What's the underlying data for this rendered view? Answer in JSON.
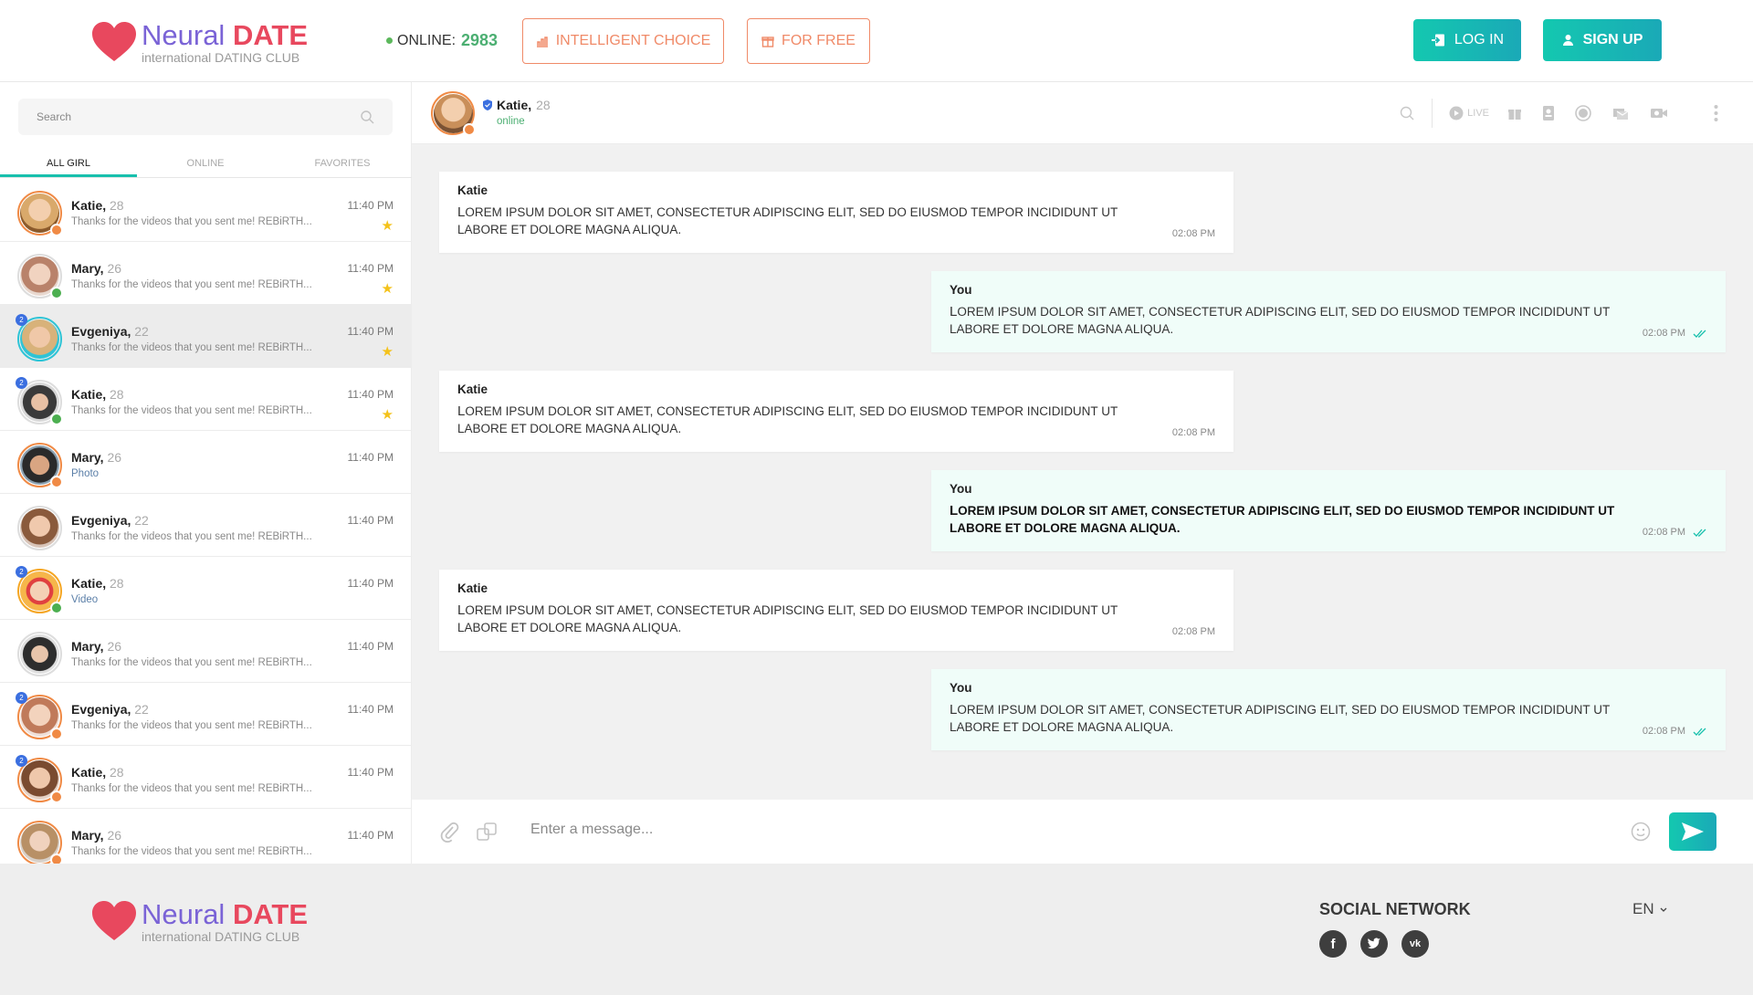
{
  "brand": {
    "name_part1": "Neural",
    "name_part2": "DATE",
    "tagline": "international DATING CLUB",
    "heart_color": "#e8485e"
  },
  "header": {
    "online_label": "ONLINE:",
    "online_count": "2983",
    "intelligent_choice_label": "INTELLIGENT CHOICE",
    "for_free_label": "FOR FREE",
    "login_label": "LOG IN",
    "signup_label": "SIGN UP"
  },
  "sidebar": {
    "search_placeholder": "Search",
    "tabs": [
      {
        "label": "ALL GIRL",
        "active": true
      },
      {
        "label": "ONLINE"
      },
      {
        "label": "FAVORITES"
      }
    ],
    "contacts": [
      {
        "name": "Katie,",
        "age": "28",
        "preview": "Thanks for the videos that you sent me! REBiRTH...",
        "time": "11:40 PM",
        "star": "★",
        "ring": "#f08a45",
        "badge": "#f08a45",
        "num": "",
        "selected": false,
        "media": false
      },
      {
        "name": "Mary,",
        "age": "26",
        "preview": "Thanks for the videos that you sent me! REBiRTH...",
        "time": "11:40 PM",
        "star": "★",
        "ring": "#dddddd",
        "badge": "#4caf50",
        "num": "",
        "selected": false,
        "media": false
      },
      {
        "name": "Evgeniya,",
        "age": "22",
        "preview": "Thanks for the videos that you sent me! REBiRTH...",
        "time": "11:40 PM",
        "star": "★",
        "ring": "#2ec4d6",
        "badge": "",
        "num": "2",
        "selected": true,
        "media": false
      },
      {
        "name": "Katie,",
        "age": "28",
        "preview": "Thanks for the videos that you sent me! REBiRTH...",
        "time": "11:40 PM",
        "star": "★",
        "ring": "#dddddd",
        "badge": "#4caf50",
        "num": "2",
        "selected": false,
        "media": false
      },
      {
        "name": "Mary,",
        "age": "26",
        "preview": "Photo",
        "time": "11:40 PM",
        "star": "",
        "ring": "#f08a45",
        "badge": "#f08a45",
        "num": "",
        "selected": false,
        "media": true
      },
      {
        "name": "Evgeniya,",
        "age": "22",
        "preview": "Thanks for the videos that you sent me! REBiRTH...",
        "time": "11:40 PM",
        "star": "",
        "ring": "#dddddd",
        "badge": "",
        "num": "",
        "selected": false,
        "media": false
      },
      {
        "name": "Katie,",
        "age": "28",
        "preview": "Video",
        "time": "11:40 PM",
        "star": "",
        "ring": "#f5a623",
        "badge": "#4caf50",
        "num": "2",
        "selected": false,
        "media": true
      },
      {
        "name": "Mary,",
        "age": "26",
        "preview": "Thanks for the videos that you sent me! REBiRTH...",
        "time": "11:40 PM",
        "star": "",
        "ring": "#dddddd",
        "badge": "",
        "num": "",
        "selected": false,
        "media": false
      },
      {
        "name": "Evgeniya,",
        "age": "22",
        "preview": "Thanks for the videos that you sent me! REBiRTH...",
        "time": "11:40 PM",
        "star": "",
        "ring": "#f08a45",
        "badge": "#f08a45",
        "num": "2",
        "selected": false,
        "media": false
      },
      {
        "name": "Katie,",
        "age": "28",
        "preview": "Thanks for the videos that you sent me! REBiRTH...",
        "time": "11:40 PM",
        "star": "",
        "ring": "#f08a45",
        "badge": "#f08a45",
        "num": "2",
        "selected": false,
        "media": false
      },
      {
        "name": "Mary,",
        "age": "26",
        "preview": "Thanks for the videos that you sent me! REBiRTH...",
        "time": "11:40 PM",
        "star": "",
        "ring": "#f08a45",
        "badge": "#f08a45",
        "num": "",
        "selected": false,
        "media": false
      }
    ]
  },
  "chat": {
    "contact_name": "Katie,",
    "contact_age": "28",
    "contact_status": "online",
    "live_label": "LIVE",
    "messages": [
      {
        "dir": "in",
        "author": "Katie",
        "text": "LOREM IPSUM DOLOR SIT AMET, CONSECTETUR ADIPISCING ELIT, SED DO EIUSMOD TEMPOR INCIDIDUNT UT LABORE ET DOLORE MAGNA ALIQUA.",
        "time": "02:08 PM",
        "bold": false
      },
      {
        "dir": "out",
        "author": "You",
        "text": "LOREM IPSUM DOLOR SIT AMET, CONSECTETUR ADIPISCING ELIT, SED DO EIUSMOD TEMPOR INCIDIDUNT UT LABORE ET DOLORE MAGNA ALIQUA.",
        "time": "02:08 PM",
        "bold": false
      },
      {
        "dir": "in",
        "author": "Katie",
        "text": "LOREM IPSUM DOLOR SIT AMET, CONSECTETUR ADIPISCING ELIT, SED DO EIUSMOD TEMPOR INCIDIDUNT UT LABORE ET DOLORE MAGNA ALIQUA.",
        "time": "02:08 PM",
        "bold": false
      },
      {
        "dir": "out",
        "author": "You",
        "text": "LOREM IPSUM DOLOR SIT AMET, CONSECTETUR ADIPISCING ELIT, SED DO EIUSMOD TEMPOR INCIDIDUNT UT LABORE ET DOLORE MAGNA ALIQUA.",
        "time": "02:08 PM",
        "bold": true
      },
      {
        "dir": "in",
        "author": "Katie",
        "text": "LOREM IPSUM DOLOR SIT AMET, CONSECTETUR ADIPISCING ELIT, SED DO EIUSMOD TEMPOR INCIDIDUNT UT LABORE ET DOLORE MAGNA ALIQUA.",
        "time": "02:08 PM",
        "bold": false
      },
      {
        "dir": "out",
        "author": "You",
        "text": "LOREM IPSUM DOLOR SIT AMET, CONSECTETUR ADIPISCING ELIT, SED DO EIUSMOD TEMPOR INCIDIDUNT UT LABORE ET DOLORE MAGNA ALIQUA.",
        "time": "02:08 PM",
        "bold": false
      }
    ],
    "composer_placeholder": "Enter a message..."
  },
  "footer": {
    "social_title": "SOCIAL NETWORK",
    "social_icons": [
      "facebook-icon",
      "twitter-icon",
      "vk-icon"
    ],
    "language": "EN"
  },
  "colors": {
    "accent": "#18c0ad",
    "orange": "#f08a68",
    "online_green": "#4caf72"
  }
}
